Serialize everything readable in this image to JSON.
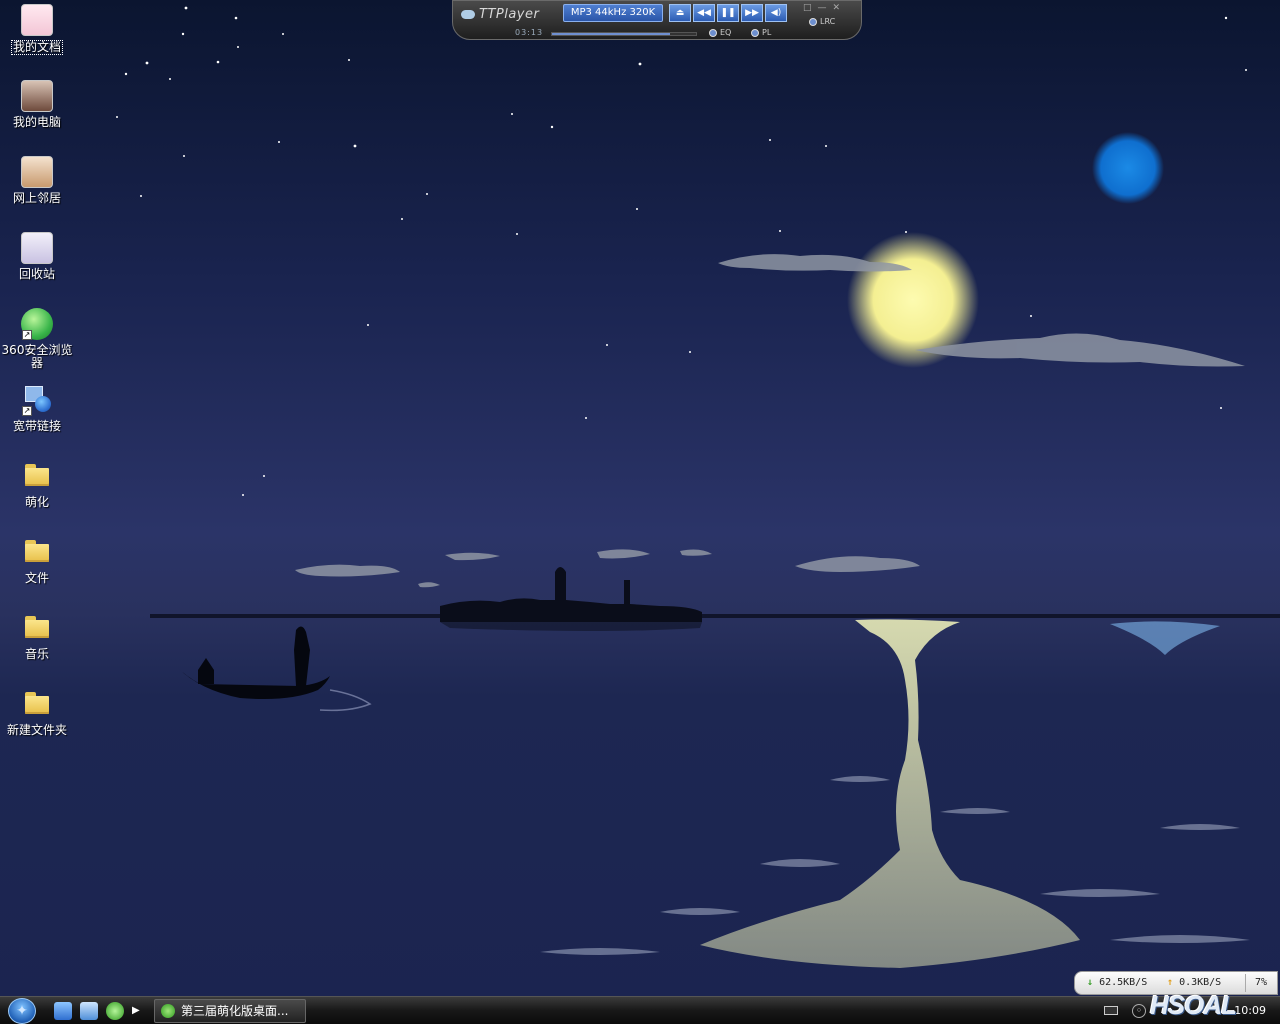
{
  "desktop": {
    "icons": [
      {
        "label": "我的文档",
        "kind": "avatar",
        "color": "#f3c6d6",
        "selected": true
      },
      {
        "label": "我的电脑",
        "kind": "avatar",
        "color": "#6e4a3c"
      },
      {
        "label": "网上邻居",
        "kind": "avatar",
        "color": "#c89a6e"
      },
      {
        "label": "回收站",
        "kind": "avatar",
        "color": "#c9c2e2"
      },
      {
        "label": "360安全浏览器",
        "kind": "app-shortcut",
        "color": "#39b54a"
      },
      {
        "label": "宽带链接",
        "kind": "network-shortcut",
        "color": "#2e6fd1"
      },
      {
        "label": "萌化",
        "kind": "folder"
      },
      {
        "label": "文件",
        "kind": "folder"
      },
      {
        "label": "音乐",
        "kind": "folder"
      },
      {
        "label": "新建文件夹",
        "kind": "folder"
      }
    ]
  },
  "player": {
    "brand": "TTPlayer",
    "format": "MP3 44kHz 320K",
    "buttons": [
      "eject",
      "prev",
      "pause",
      "next",
      "mute"
    ],
    "button_glyphs": [
      "⏏",
      "◀◀",
      "❚❚",
      "▶▶",
      "◀)"
    ],
    "time": "03:13",
    "progress": 0.82,
    "eq_label": "EQ",
    "pl_label": "PL",
    "lrc_label": "LRC"
  },
  "netmon": {
    "down": "62.5KB/S",
    "up": "0.3KB/S",
    "pct": "7%"
  },
  "taskbar": {
    "task_label": "第三届萌化版桌面...",
    "clock": "10:09",
    "quicklaunch": [
      "desktop-show-icon",
      "ie-icon",
      "refresh-icon",
      "media-icon"
    ]
  },
  "watermark": "HSOAL"
}
